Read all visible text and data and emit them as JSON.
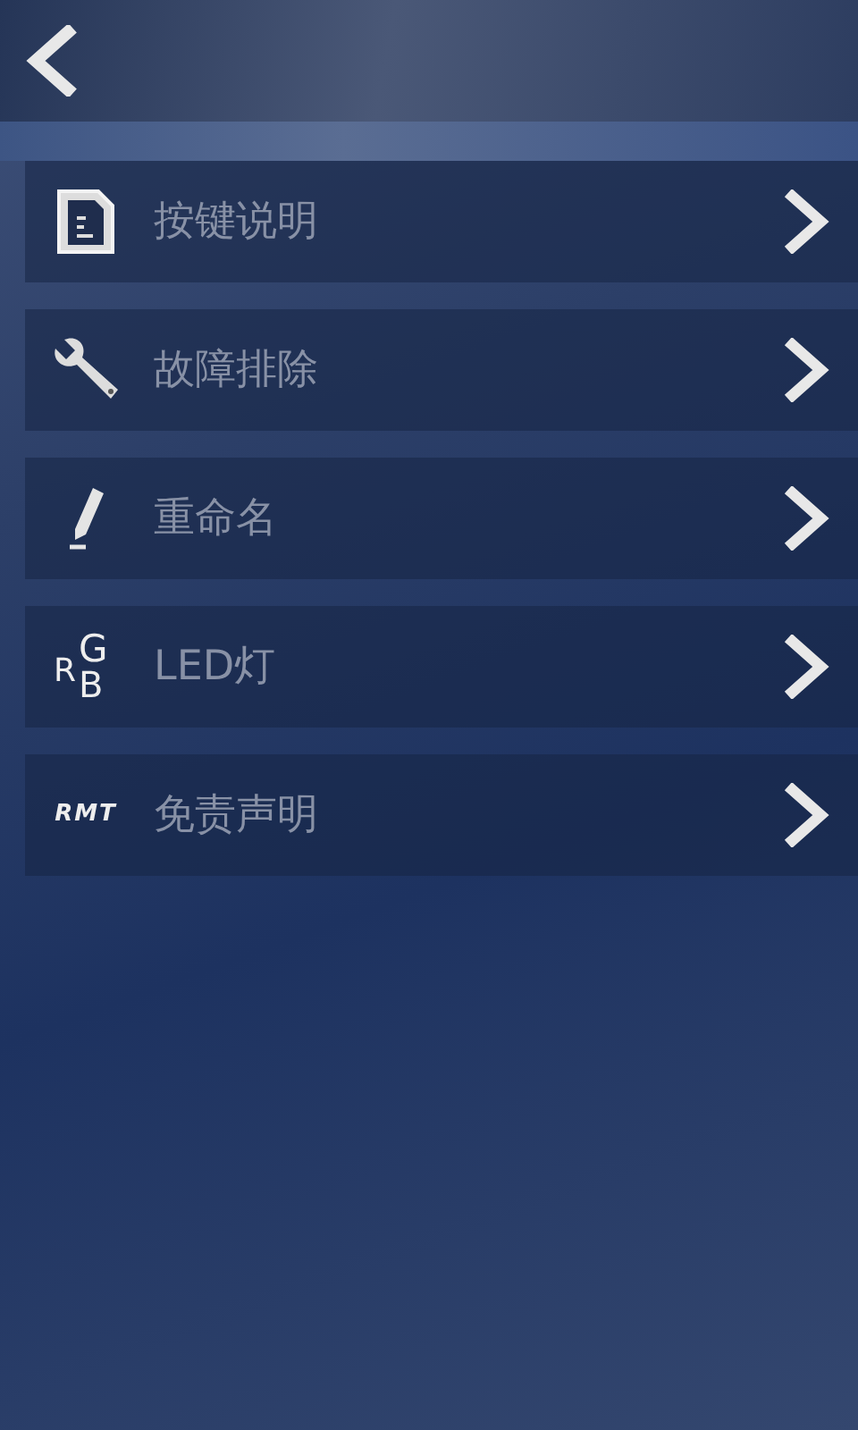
{
  "menu": [
    {
      "kind": "document",
      "label": "按键说明"
    },
    {
      "kind": "wrench",
      "label": "故障排除"
    },
    {
      "kind": "pencil",
      "label": "重命名"
    },
    {
      "kind": "rgb",
      "icon_letters": [
        "R",
        "G",
        "B"
      ],
      "label": "LED灯"
    },
    {
      "kind": "logo",
      "icon_text": "RMT",
      "label": "免责声明"
    }
  ]
}
